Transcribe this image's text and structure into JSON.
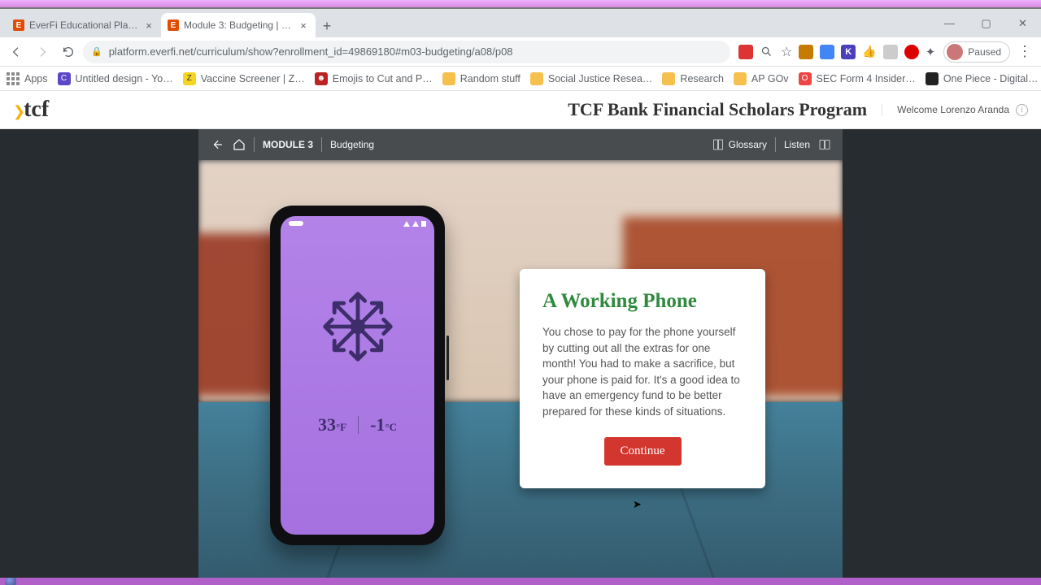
{
  "browser": {
    "tabs": [
      {
        "title": "EverFi Educational Platform",
        "favicon": "E"
      },
      {
        "title": "Module 3: Budgeting | a08",
        "favicon": "E"
      }
    ],
    "url": "platform.everfi.net/curriculum/show?enrollment_id=49869180#m03-budgeting/a08/p08",
    "profile_label": "Paused"
  },
  "bookmarks": {
    "apps": "Apps",
    "items": [
      "Untitled design - Yo…",
      "Vaccine Screener | Z…",
      "Emojis to Cut and P…",
      "Random stuff",
      "Social Justice Resea…",
      "Research",
      "AP GOv",
      "SEC Form 4 Insider…",
      "One Piece - Digital…"
    ]
  },
  "tcf": {
    "logo_text": "tcf",
    "program": "TCF Bank Financial Scholars Program",
    "welcome": "Welcome Lorenzo Aranda"
  },
  "module_bar": {
    "module": "MODULE 3",
    "name": "Budgeting",
    "glossary": "Glossary",
    "listen": "Listen"
  },
  "phone": {
    "temp_f_num": "33",
    "temp_f_unit": "°F",
    "temp_c_num": "-1",
    "temp_c_unit": "°C"
  },
  "card": {
    "title": "A Working Phone",
    "body": "You chose to pay for the phone yourself by cutting out all the extras for one month! You had to make a sacrifice, but your phone is paid for. It's a good idea to have an emergency fund to be better prepared for these kinds of situations.",
    "button": "Continue"
  }
}
